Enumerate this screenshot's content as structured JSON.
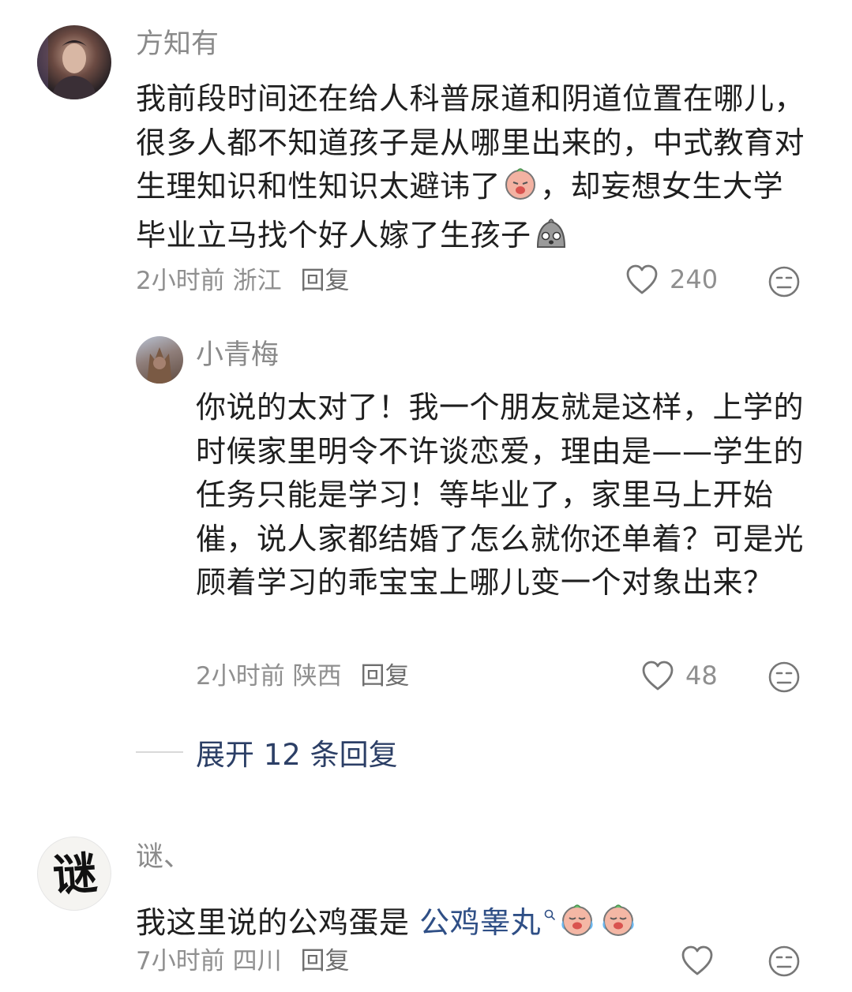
{
  "comments": [
    {
      "username": "方知有",
      "text_parts": [
        "我前段时间还在给人科普尿道和阴道位置在哪儿，很多人都不知道孩子是从哪里出来的，中式教育对生理知识和性知识太避讳了",
        "，却妄想女生大学毕业立马找个好人嫁了生孩子"
      ],
      "time": "2小时前",
      "location": "浙江",
      "reply_label": "回复",
      "likes": "240",
      "icons": [
        "crying-emoji-icon",
        "shocked-emoji-icon",
        "heart-icon",
        "dislike-face-icon"
      ]
    },
    {
      "username": "小青梅",
      "text": "你说的太对了！我一个朋友就是这样，上学的时候家里明令不许谈恋爱，理由是——学生的任务只能是学习！等毕业了，家里马上开始催，说人家都结婚了怎么就你还单着？可是光顾着学习的乖宝宝上哪儿变一个对象出来？",
      "time": "2小时前",
      "location": "陕西",
      "reply_label": "回复",
      "likes": "48"
    }
  ],
  "expand_label": "展开 12 条回复",
  "third_comment": {
    "username": "谜、",
    "avatar_char": "谜",
    "text_prefix": "我这里说的公鸡蛋是 ",
    "link_text": "公鸡睾丸",
    "time": "7小时前",
    "location": "四川",
    "reply_label": "回复"
  },
  "colors": {
    "username": "#8a8a8a",
    "body": "#1f1f1f",
    "meta": "#8f8f8f",
    "link": "#2f4f86",
    "expand": "#2c3f66"
  }
}
